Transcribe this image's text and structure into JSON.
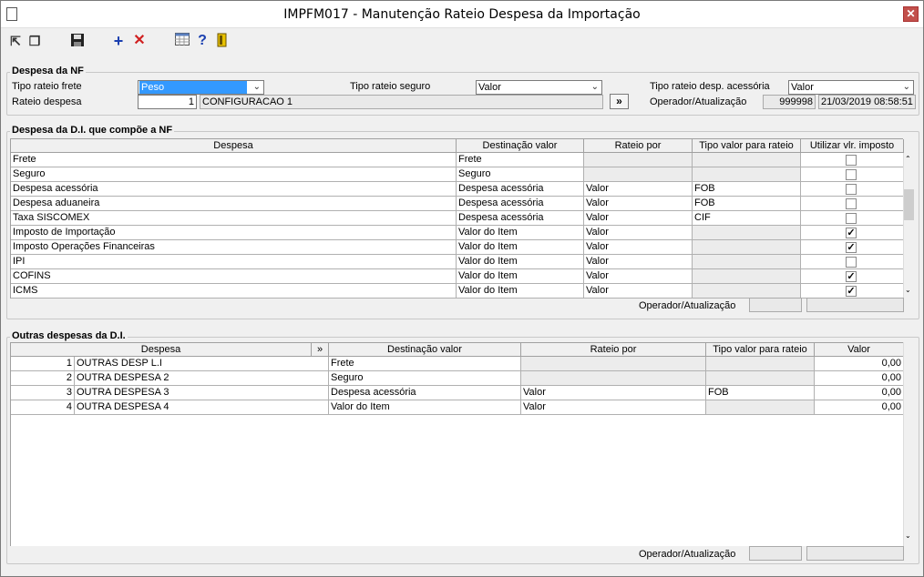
{
  "window": {
    "title": "IMPFM017 - Manutenção Rateio Despesa da Importação",
    "close": "✕"
  },
  "toolbar": {
    "icons": [
      "back-icon",
      "copy-icon",
      "save-icon",
      "add-icon",
      "delete-icon",
      "calendar-icon",
      "help-icon",
      "exit-icon"
    ]
  },
  "nf": {
    "section": "Despesa da NF",
    "tipo_frete_label": "Tipo rateio frete",
    "tipo_frete": "Peso",
    "tipo_seguro_label": "Tipo rateio seguro",
    "tipo_seguro": "Valor",
    "tipo_desp_label": "Tipo rateio desp. acessória",
    "tipo_desp": "Valor",
    "rateio_label": "Rateio despesa",
    "rateio_num": "1",
    "rateio_desc": "CONFIGURACAO 1",
    "btn_more": "»",
    "operador_label": "Operador/Atualização",
    "operador": "999998",
    "data": "21/03/2019 08:58:51"
  },
  "di": {
    "section": "Despesa da D.I. que compõe a NF",
    "headers": [
      "Despesa",
      "Destinação valor",
      "Rateio por",
      "Tipo valor para rateio",
      "Utilizar vlr. imposto"
    ],
    "rows": [
      [
        "Frete",
        "Frete",
        "",
        "",
        false
      ],
      [
        "Seguro",
        "Seguro",
        "",
        "",
        false
      ],
      [
        "Despesa acessória",
        "Despesa acessória",
        "Valor",
        "FOB",
        false
      ],
      [
        "Despesa aduaneira",
        "Despesa acessória",
        "Valor",
        "FOB",
        false
      ],
      [
        "Taxa SISCOMEX",
        "Despesa acessória",
        "Valor",
        "CIF",
        false
      ],
      [
        "Imposto de Importação",
        "Valor do Item",
        "Valor",
        "",
        true
      ],
      [
        "Imposto Operações Financeiras",
        "Valor do Item",
        "Valor",
        "",
        true
      ],
      [
        "IPI",
        "Valor do Item",
        "Valor",
        "",
        false
      ],
      [
        "COFINS",
        "Valor do Item",
        "Valor",
        "",
        true
      ],
      [
        "ICMS",
        "Valor do Item",
        "Valor",
        "",
        true
      ]
    ],
    "operador_label": "Operador/Atualização"
  },
  "outras": {
    "section": "Outras despesas da D.I.",
    "headers": [
      "Despesa",
      "»",
      "Destinação valor",
      "Rateio por",
      "Tipo valor para rateio",
      "Valor"
    ],
    "rows": [
      [
        "1",
        "OUTRAS DESP L.I",
        "Frete",
        "",
        "",
        "0,00"
      ],
      [
        "2",
        "OUTRA DESPESA 2",
        "Seguro",
        "",
        "",
        "0,00"
      ],
      [
        "3",
        "OUTRA DESPESA 3",
        "Despesa acessória",
        "Valor",
        "FOB",
        "0,00"
      ],
      [
        "4",
        "OUTRA DESPESA 4",
        "Valor do Item",
        "Valor",
        "",
        "0,00"
      ]
    ],
    "operador_label": "Operador/Atualização"
  },
  "scroll": {
    "up": "▲",
    "down": "▼"
  }
}
